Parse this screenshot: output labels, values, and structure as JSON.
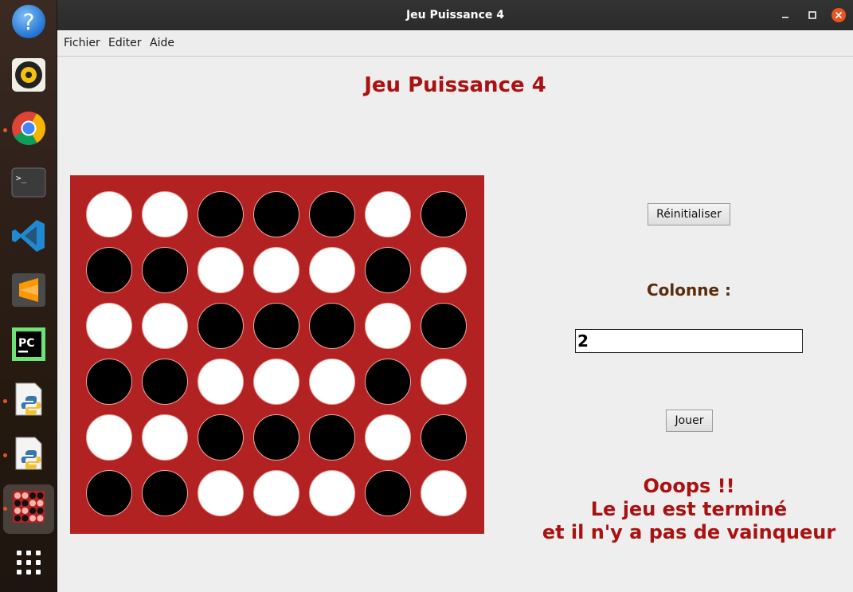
{
  "window": {
    "title": "Jeu Puissance 4"
  },
  "menu": {
    "items": [
      "Fichier",
      "Editer",
      "Aide"
    ]
  },
  "game": {
    "title": "Jeu Puissance 4",
    "board": {
      "columns": 7,
      "rows": 6,
      "cells": [
        [
          "white",
          "white",
          "black",
          "black",
          "black",
          "white",
          "black"
        ],
        [
          "black",
          "black",
          "white",
          "white",
          "white",
          "black",
          "white"
        ],
        [
          "white",
          "white",
          "black",
          "black",
          "black",
          "white",
          "black"
        ],
        [
          "black",
          "black",
          "white",
          "white",
          "white",
          "black",
          "white"
        ],
        [
          "white",
          "white",
          "black",
          "black",
          "black",
          "white",
          "black"
        ],
        [
          "black",
          "black",
          "white",
          "white",
          "white",
          "black",
          "white"
        ]
      ]
    },
    "reset_label": "Réinitialiser",
    "column_label": "Colonne :",
    "column_value": "2",
    "play_label": "Jouer",
    "result": [
      "Ooops !!",
      "Le jeu est terminé",
      "et il n'y a pas de vainqueur"
    ]
  },
  "dock": {
    "items": [
      {
        "icon": "help-icon",
        "running": false,
        "active": false
      },
      {
        "icon": "rhythmbox-icon",
        "running": false,
        "active": false
      },
      {
        "icon": "chrome-icon",
        "running": true,
        "active": false
      },
      {
        "icon": "terminal-icon",
        "running": false,
        "active": false
      },
      {
        "icon": "vscode-icon",
        "running": false,
        "active": false
      },
      {
        "icon": "sublime-text-icon",
        "running": false,
        "active": false
      },
      {
        "icon": "pycharm-icon",
        "running": false,
        "active": false
      },
      {
        "icon": "python-file-icon",
        "running": true,
        "active": false
      },
      {
        "icon": "python-file-icon",
        "running": true,
        "active": false
      },
      {
        "icon": "connect4-app-icon",
        "running": true,
        "active": true
      },
      {
        "icon": "app-grid-icon",
        "running": false,
        "active": false
      }
    ]
  },
  "colors": {
    "board": "#b22222",
    "title": "#aa1111",
    "label": "#5a2d0c",
    "message": "#aa1111",
    "disc_white": "#ffffff",
    "disc_black": "#000000"
  }
}
